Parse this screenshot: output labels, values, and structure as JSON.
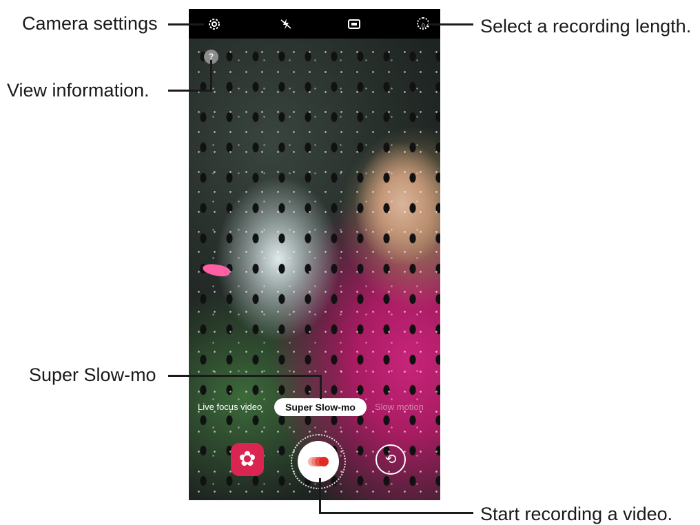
{
  "callouts": {
    "camera_settings": "Camera settings",
    "view_information": "View information.",
    "recording_length": "Select a recording length.",
    "super_slow_mo": "Super Slow-mo",
    "start_recording": "Start recording a video."
  },
  "topbar": {
    "settings_icon": "gear-icon",
    "flash_icon": "flash-off-icon",
    "ratio_icon": "aspect-ratio-icon",
    "record_length_value": "0.4"
  },
  "help": {
    "label": "?"
  },
  "modes": {
    "left": "Live focus video",
    "center": "Super Slow-mo",
    "right": "Slow motion"
  },
  "colors": {
    "shutter_red": "#e02a22",
    "bixby_red": "#d9254f",
    "topbar": "#000000"
  }
}
